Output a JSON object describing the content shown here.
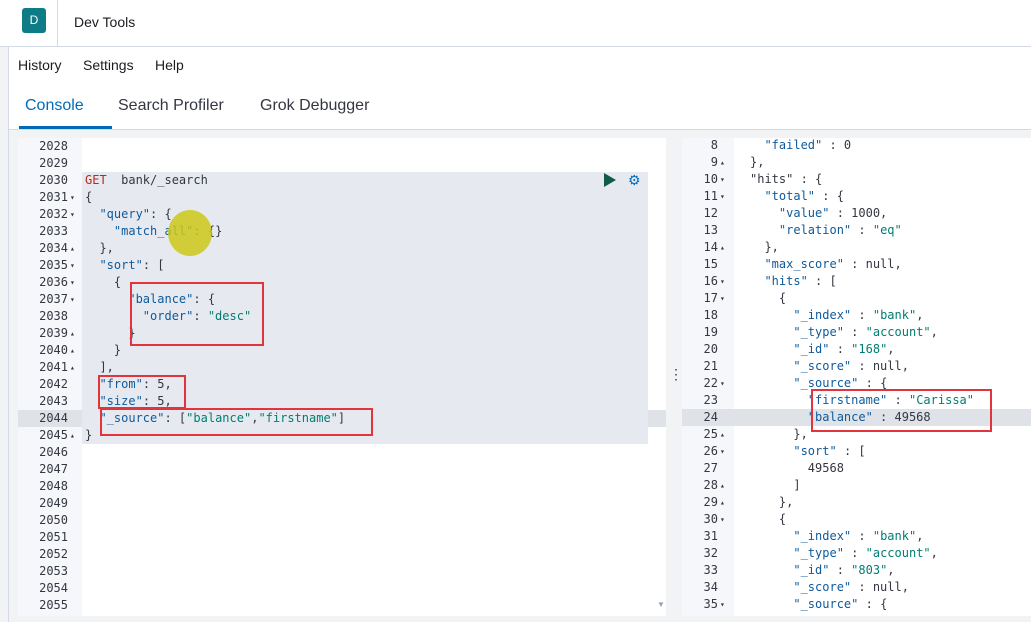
{
  "app": {
    "logo_letter": "D",
    "title": "Dev Tools"
  },
  "menu": [
    "History",
    "Settings",
    "Help"
  ],
  "tabs": [
    "Console",
    "Search Profiler",
    "Grok Debugger"
  ],
  "request": {
    "lines": [
      {
        "n": "2028",
        "f": "",
        "t": []
      },
      {
        "n": "2029",
        "f": "",
        "t": []
      },
      {
        "n": "2030",
        "f": "",
        "t": [
          [
            "m",
            "GET"
          ],
          [
            "",
            "  bank/_search"
          ]
        ]
      },
      {
        "n": "2031",
        "f": "▾",
        "t": [
          [
            "",
            "{"
          ]
        ]
      },
      {
        "n": "2032",
        "f": "▾",
        "t": [
          [
            "",
            "  "
          ],
          [
            "k",
            "\"query\""
          ],
          [
            "",
            ": {"
          ]
        ]
      },
      {
        "n": "2033",
        "f": "",
        "t": [
          [
            "",
            "    "
          ],
          [
            "k",
            "\"match_all\""
          ],
          [
            "",
            ": {}"
          ]
        ]
      },
      {
        "n": "2034",
        "f": "▴",
        "t": [
          [
            "",
            "  },"
          ]
        ]
      },
      {
        "n": "2035",
        "f": "▾",
        "t": [
          [
            "",
            "  "
          ],
          [
            "k",
            "\"sort\""
          ],
          [
            "",
            ": ["
          ]
        ]
      },
      {
        "n": "2036",
        "f": "▾",
        "t": [
          [
            "",
            "    {"
          ]
        ]
      },
      {
        "n": "2037",
        "f": "▾",
        "t": [
          [
            "",
            "      "
          ],
          [
            "k",
            "\"balance\""
          ],
          [
            "",
            ": {"
          ]
        ]
      },
      {
        "n": "2038",
        "f": "",
        "t": [
          [
            "",
            "        "
          ],
          [
            "k",
            "\"order\""
          ],
          [
            "",
            ": "
          ],
          [
            "s",
            "\"desc\""
          ]
        ]
      },
      {
        "n": "2039",
        "f": "▴",
        "t": [
          [
            "",
            "      }"
          ]
        ]
      },
      {
        "n": "2040",
        "f": "▴",
        "t": [
          [
            "",
            "    }"
          ]
        ]
      },
      {
        "n": "2041",
        "f": "▴",
        "t": [
          [
            "",
            "  ],"
          ]
        ]
      },
      {
        "n": "2042",
        "f": "",
        "t": [
          [
            "",
            "  "
          ],
          [
            "k",
            "\"from\""
          ],
          [
            "",
            ": 5,"
          ]
        ]
      },
      {
        "n": "2043",
        "f": "",
        "t": [
          [
            "",
            "  "
          ],
          [
            "k",
            "\"size\""
          ],
          [
            "",
            ": 5,"
          ]
        ]
      },
      {
        "n": "2044",
        "f": "",
        "t": [
          [
            "",
            "  "
          ],
          [
            "k",
            "\"_source\""
          ],
          [
            "",
            ": ["
          ],
          [
            "s",
            "\"balance\""
          ],
          [
            "",
            ","
          ],
          [
            "s",
            "\"firstname\""
          ],
          [
            "",
            "]"
          ]
        ]
      },
      {
        "n": "2045",
        "f": "▴",
        "t": [
          [
            "",
            "}"
          ]
        ]
      },
      {
        "n": "2046",
        "f": "",
        "t": []
      },
      {
        "n": "2047",
        "f": "",
        "t": []
      },
      {
        "n": "2048",
        "f": "",
        "t": []
      },
      {
        "n": "2049",
        "f": "",
        "t": []
      },
      {
        "n": "2050",
        "f": "",
        "t": []
      },
      {
        "n": "2051",
        "f": "",
        "t": []
      },
      {
        "n": "2052",
        "f": "",
        "t": []
      },
      {
        "n": "2053",
        "f": "",
        "t": []
      },
      {
        "n": "2054",
        "f": "",
        "t": []
      },
      {
        "n": "2055",
        "f": "",
        "t": []
      }
    ]
  },
  "response": {
    "lines": [
      {
        "n": "8",
        "f": "",
        "t": [
          [
            "",
            "  "
          ],
          [
            "k",
            "\"failed\""
          ],
          [
            "",
            " : 0"
          ]
        ]
      },
      {
        "n": "9",
        "f": "▴",
        "t": [
          [
            "",
            "},"
          ]
        ]
      },
      {
        "n": "10",
        "f": "▾",
        "t": [
          [
            "",
            "\"hits\" : {"
          ]
        ]
      },
      {
        "n": "11",
        "f": "▾",
        "t": [
          [
            "",
            "  "
          ],
          [
            "k",
            "\"total\""
          ],
          [
            "",
            " : {"
          ]
        ]
      },
      {
        "n": "12",
        "f": "",
        "t": [
          [
            "",
            "    "
          ],
          [
            "k",
            "\"value\""
          ],
          [
            "",
            " : 1000,"
          ]
        ]
      },
      {
        "n": "13",
        "f": "",
        "t": [
          [
            "",
            "    "
          ],
          [
            "k",
            "\"relation\""
          ],
          [
            "",
            " : "
          ],
          [
            "s",
            "\"eq\""
          ]
        ]
      },
      {
        "n": "14",
        "f": "▴",
        "t": [
          [
            "",
            "  },"
          ]
        ]
      },
      {
        "n": "15",
        "f": "",
        "t": [
          [
            "",
            "  "
          ],
          [
            "k",
            "\"max_score\""
          ],
          [
            "",
            " : null,"
          ]
        ]
      },
      {
        "n": "16",
        "f": "▾",
        "t": [
          [
            "",
            "  "
          ],
          [
            "k",
            "\"hits\""
          ],
          [
            "",
            " : ["
          ]
        ]
      },
      {
        "n": "17",
        "f": "▾",
        "t": [
          [
            "",
            "    {"
          ]
        ]
      },
      {
        "n": "18",
        "f": "",
        "t": [
          [
            "",
            "      "
          ],
          [
            "k",
            "\"_index\""
          ],
          [
            "",
            " : "
          ],
          [
            "s",
            "\"bank\""
          ],
          [
            "",
            ","
          ]
        ]
      },
      {
        "n": "19",
        "f": "",
        "t": [
          [
            "",
            "      "
          ],
          [
            "k",
            "\"_type\""
          ],
          [
            "",
            " : "
          ],
          [
            "s",
            "\"account\""
          ],
          [
            "",
            ","
          ]
        ]
      },
      {
        "n": "20",
        "f": "",
        "t": [
          [
            "",
            "      "
          ],
          [
            "k",
            "\"_id\""
          ],
          [
            "",
            " : "
          ],
          [
            "s",
            "\"168\""
          ],
          [
            "",
            ","
          ]
        ]
      },
      {
        "n": "21",
        "f": "",
        "t": [
          [
            "",
            "      "
          ],
          [
            "k",
            "\"_score\""
          ],
          [
            "",
            " : null,"
          ]
        ]
      },
      {
        "n": "22",
        "f": "▾",
        "t": [
          [
            "",
            "      "
          ],
          [
            "k",
            "\"_source\""
          ],
          [
            "",
            " : {"
          ]
        ]
      },
      {
        "n": "23",
        "f": "",
        "t": [
          [
            "",
            "        "
          ],
          [
            "k",
            "\"firstname\""
          ],
          [
            "",
            " : "
          ],
          [
            "s",
            "\"Carissa\""
          ]
        ]
      },
      {
        "n": "24",
        "f": "",
        "t": [
          [
            "",
            "        "
          ],
          [
            "k",
            "\"balance\""
          ],
          [
            "",
            " : 49568"
          ]
        ]
      },
      {
        "n": "25",
        "f": "▴",
        "t": [
          [
            "",
            "      },"
          ]
        ]
      },
      {
        "n": "26",
        "f": "▾",
        "t": [
          [
            "",
            "      "
          ],
          [
            "k",
            "\"sort\""
          ],
          [
            "",
            " : ["
          ]
        ]
      },
      {
        "n": "27",
        "f": "",
        "t": [
          [
            "",
            "        49568"
          ]
        ]
      },
      {
        "n": "28",
        "f": "▴",
        "t": [
          [
            "",
            "      ]"
          ]
        ]
      },
      {
        "n": "29",
        "f": "▴",
        "t": [
          [
            "",
            "    },"
          ]
        ]
      },
      {
        "n": "30",
        "f": "▾",
        "t": [
          [
            "",
            "    {"
          ]
        ]
      },
      {
        "n": "31",
        "f": "",
        "t": [
          [
            "",
            "      "
          ],
          [
            "k",
            "\"_index\""
          ],
          [
            "",
            " : "
          ],
          [
            "s",
            "\"bank\""
          ],
          [
            "",
            ","
          ]
        ]
      },
      {
        "n": "32",
        "f": "",
        "t": [
          [
            "",
            "      "
          ],
          [
            "k",
            "\"_type\""
          ],
          [
            "",
            " : "
          ],
          [
            "s",
            "\"account\""
          ],
          [
            "",
            ","
          ]
        ]
      },
      {
        "n": "33",
        "f": "",
        "t": [
          [
            "",
            "      "
          ],
          [
            "k",
            "\"_id\""
          ],
          [
            "",
            " : "
          ],
          [
            "s",
            "\"803\""
          ],
          [
            "",
            ","
          ]
        ]
      },
      {
        "n": "34",
        "f": "",
        "t": [
          [
            "",
            "      "
          ],
          [
            "k",
            "\"_score\""
          ],
          [
            "",
            " : null,"
          ]
        ]
      },
      {
        "n": "35",
        "f": "▾",
        "t": [
          [
            "",
            "      "
          ],
          [
            "k",
            "\"_source\""
          ],
          [
            "",
            " : {"
          ]
        ]
      }
    ]
  },
  "icons": {
    "play": "play-icon",
    "wrench": "wrench-icon",
    "divider": "panel-resize-handle-icon"
  }
}
